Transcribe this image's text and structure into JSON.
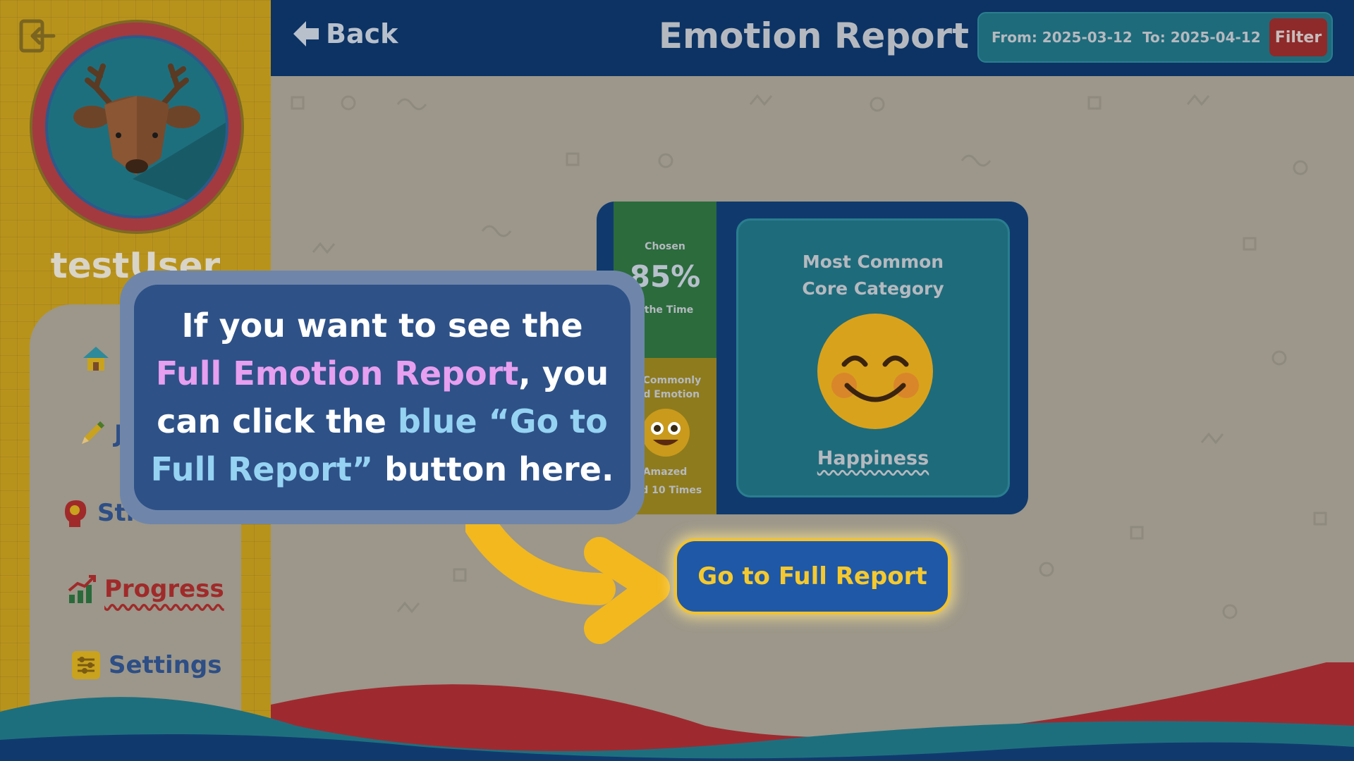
{
  "sidebar": {
    "username": "testUser",
    "nav": [
      {
        "label": "",
        "icon": "home-icon"
      },
      {
        "label": "J",
        "icon": "pencil-icon"
      },
      {
        "label": "Stra",
        "icon": "head-icon"
      },
      {
        "label": "Progress",
        "icon": "chart-icon",
        "active": true
      },
      {
        "label": "Settings",
        "icon": "sliders-icon"
      }
    ]
  },
  "header": {
    "back_label": "Back",
    "title": "Emotion Report",
    "from_label": "From: 2025-03-12",
    "to_label": "To: 2025-04-12",
    "filter_label": "Filter"
  },
  "report": {
    "chosen_label": "Chosen",
    "chosen_percent": "85%",
    "chosen_suffix": "f the Time",
    "common_label_1": "st Commonly",
    "common_label_2": "ked Emotion",
    "emotion_name": "Amazed",
    "emotion_times": "ked 10 Times",
    "core_title_1": "Most Common",
    "core_title_2": "Core Category",
    "core_name": "Happiness"
  },
  "full_report_button": "Go to Full Report",
  "tooltip": {
    "part1": "If you want to see the ",
    "highlight1": "Full Emotion Report",
    "part2": ", you can click the ",
    "highlight2": "blue “Go to Full Report”",
    "part3": " button here."
  },
  "colors": {
    "header": "#0c3364",
    "sidebar": "#b8931c",
    "accent_yellow": "#f5c92e",
    "button_blue": "#1f58a6",
    "filter_red": "#8e2a2a",
    "tooltip_bg": "#2e5187"
  }
}
